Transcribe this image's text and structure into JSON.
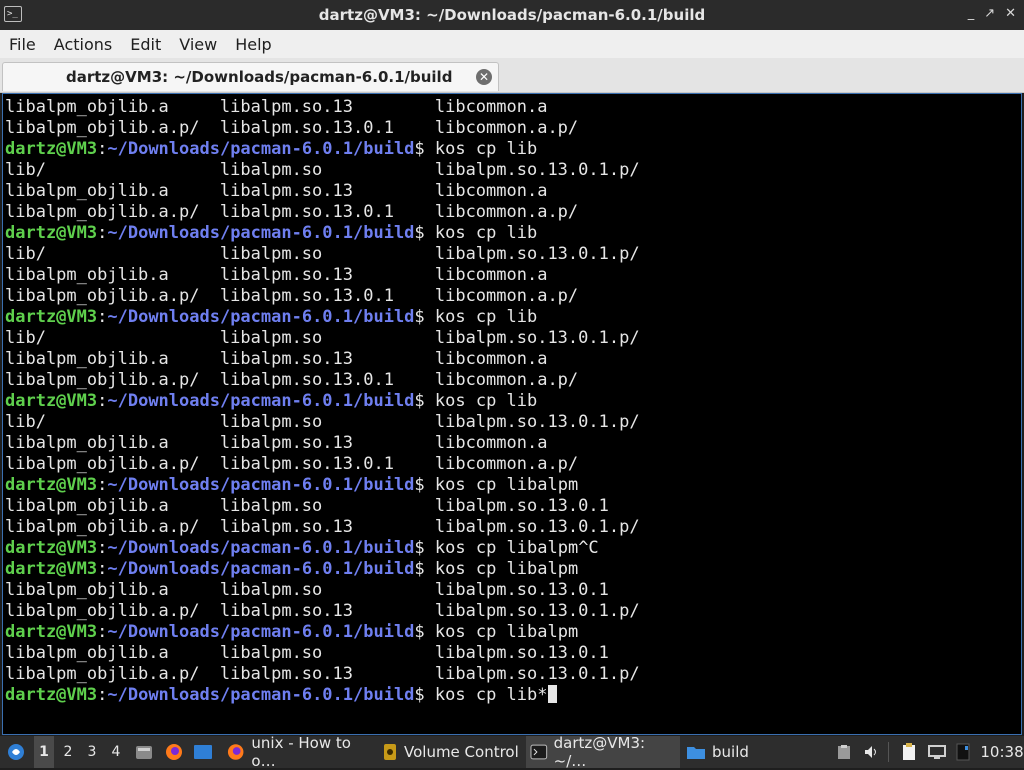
{
  "window": {
    "title": "dartz@VM3: ~/Downloads/pacman-6.0.1/build",
    "controls": [
      "_",
      "↗",
      "✕"
    ]
  },
  "menu": [
    "File",
    "Actions",
    "Edit",
    "View",
    "Help"
  ],
  "tab": {
    "label": "dartz@VM3: ~/Downloads/pacman-6.0.1/build",
    "close": "✕"
  },
  "prompt": {
    "user": "dartz@VM3",
    "path": "~/Downloads/pacman-6.0.1/build"
  },
  "terminal_lines": [
    {
      "text": "libalpm_objlib.a     libalpm.so.13        libcommon.a"
    },
    {
      "text": "libalpm_objlib.a.p/  libalpm.so.13.0.1    libcommon.a.p/"
    },
    {
      "prompt": true,
      "cmd": "kos cp lib"
    },
    {
      "text": "lib/                 libalpm.so           libalpm.so.13.0.1.p/"
    },
    {
      "text": "libalpm_objlib.a     libalpm.so.13        libcommon.a"
    },
    {
      "text": "libalpm_objlib.a.p/  libalpm.so.13.0.1    libcommon.a.p/"
    },
    {
      "prompt": true,
      "cmd": "kos cp lib"
    },
    {
      "text": "lib/                 libalpm.so           libalpm.so.13.0.1.p/"
    },
    {
      "text": "libalpm_objlib.a     libalpm.so.13        libcommon.a"
    },
    {
      "text": "libalpm_objlib.a.p/  libalpm.so.13.0.1    libcommon.a.p/"
    },
    {
      "prompt": true,
      "cmd": "kos cp lib"
    },
    {
      "text": "lib/                 libalpm.so           libalpm.so.13.0.1.p/"
    },
    {
      "text": "libalpm_objlib.a     libalpm.so.13        libcommon.a"
    },
    {
      "text": "libalpm_objlib.a.p/  libalpm.so.13.0.1    libcommon.a.p/"
    },
    {
      "prompt": true,
      "cmd": "kos cp lib"
    },
    {
      "text": "lib/                 libalpm.so           libalpm.so.13.0.1.p/"
    },
    {
      "text": "libalpm_objlib.a     libalpm.so.13        libcommon.a"
    },
    {
      "text": "libalpm_objlib.a.p/  libalpm.so.13.0.1    libcommon.a.p/"
    },
    {
      "prompt": true,
      "cmd": "kos cp libalpm"
    },
    {
      "text": "libalpm_objlib.a     libalpm.so           libalpm.so.13.0.1"
    },
    {
      "text": "libalpm_objlib.a.p/  libalpm.so.13        libalpm.so.13.0.1.p/"
    },
    {
      "prompt": true,
      "cmd": "kos cp libalpm^C"
    },
    {
      "prompt": true,
      "cmd": "kos cp libalpm"
    },
    {
      "text": "libalpm_objlib.a     libalpm.so           libalpm.so.13.0.1"
    },
    {
      "text": "libalpm_objlib.a.p/  libalpm.so.13        libalpm.so.13.0.1.p/"
    },
    {
      "prompt": true,
      "cmd": "kos cp libalpm"
    },
    {
      "text": "libalpm_objlib.a     libalpm.so           libalpm.so.13.0.1"
    },
    {
      "text": "libalpm_objlib.a.p/  libalpm.so.13        libalpm.so.13.0.1.p/"
    },
    {
      "prompt": true,
      "cmd": "kos cp lib*",
      "cursor": true
    }
  ],
  "taskbar": {
    "workspaces": [
      "1",
      "2",
      "3",
      "4"
    ],
    "active_workspace": "1",
    "tasks": [
      {
        "label": "unix - How to o…",
        "icon": "firefox-icon"
      },
      {
        "label": "Volume Control",
        "icon": "volume-control-icon"
      },
      {
        "label": "dartz@VM3: ~/…",
        "icon": "terminal-icon"
      },
      {
        "label": "build",
        "icon": "folder-icon"
      }
    ],
    "clock": "10:38"
  },
  "colors": {
    "prompt_user": "#5fd04d",
    "prompt_path": "#6f7ff0",
    "terminal_bg": "#000000",
    "terminal_fg": "#e6e6e6"
  }
}
